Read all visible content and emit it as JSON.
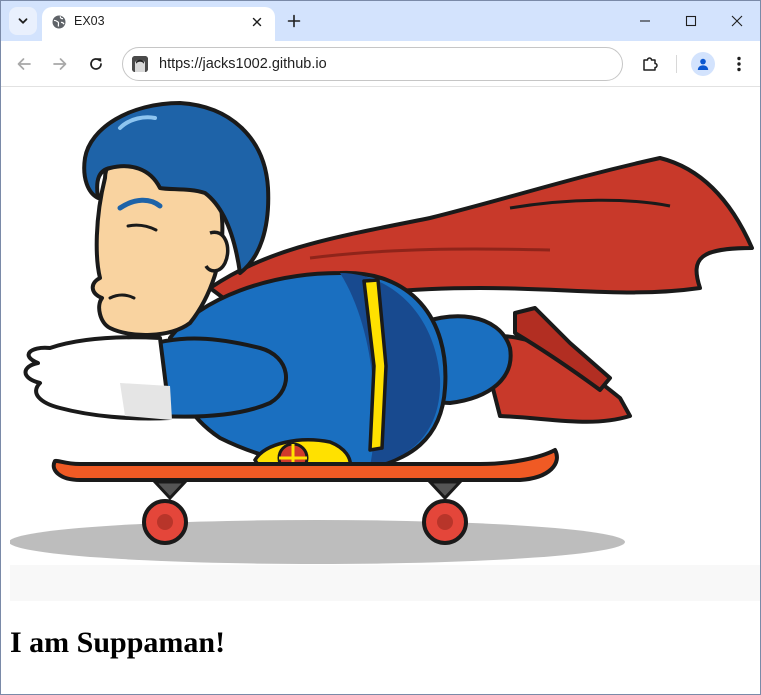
{
  "browser": {
    "tab": {
      "title": "EX03"
    },
    "omnibox": {
      "url": "https://jacks1002.github.io"
    }
  },
  "icons": {
    "tab_search": "chevron-down-icon",
    "tab_favicon": "globe-icon",
    "tab_close": "close-icon",
    "new_tab": "plus-icon",
    "minimize": "minimize-icon",
    "maximize": "maximize-icon",
    "close_window": "close-icon",
    "back": "arrow-left-icon",
    "forward": "arrow-right-icon",
    "reload": "reload-icon",
    "site_favicon": "site-favicon",
    "extensions": "puzzle-icon",
    "profile": "person-icon",
    "menu": "more-vert-icon"
  },
  "page": {
    "heading": "I am Suppaman!",
    "image_subject": "cartoon superhero lying on a skateboard"
  },
  "colors": {
    "tabstrip": "#d3e3fd",
    "hair": "#1e63a8",
    "suit": "#1a6fc0",
    "cape": "#c8392a",
    "skin": "#f9d3a0",
    "belt": "#ffe100",
    "board": "#f05a24"
  }
}
